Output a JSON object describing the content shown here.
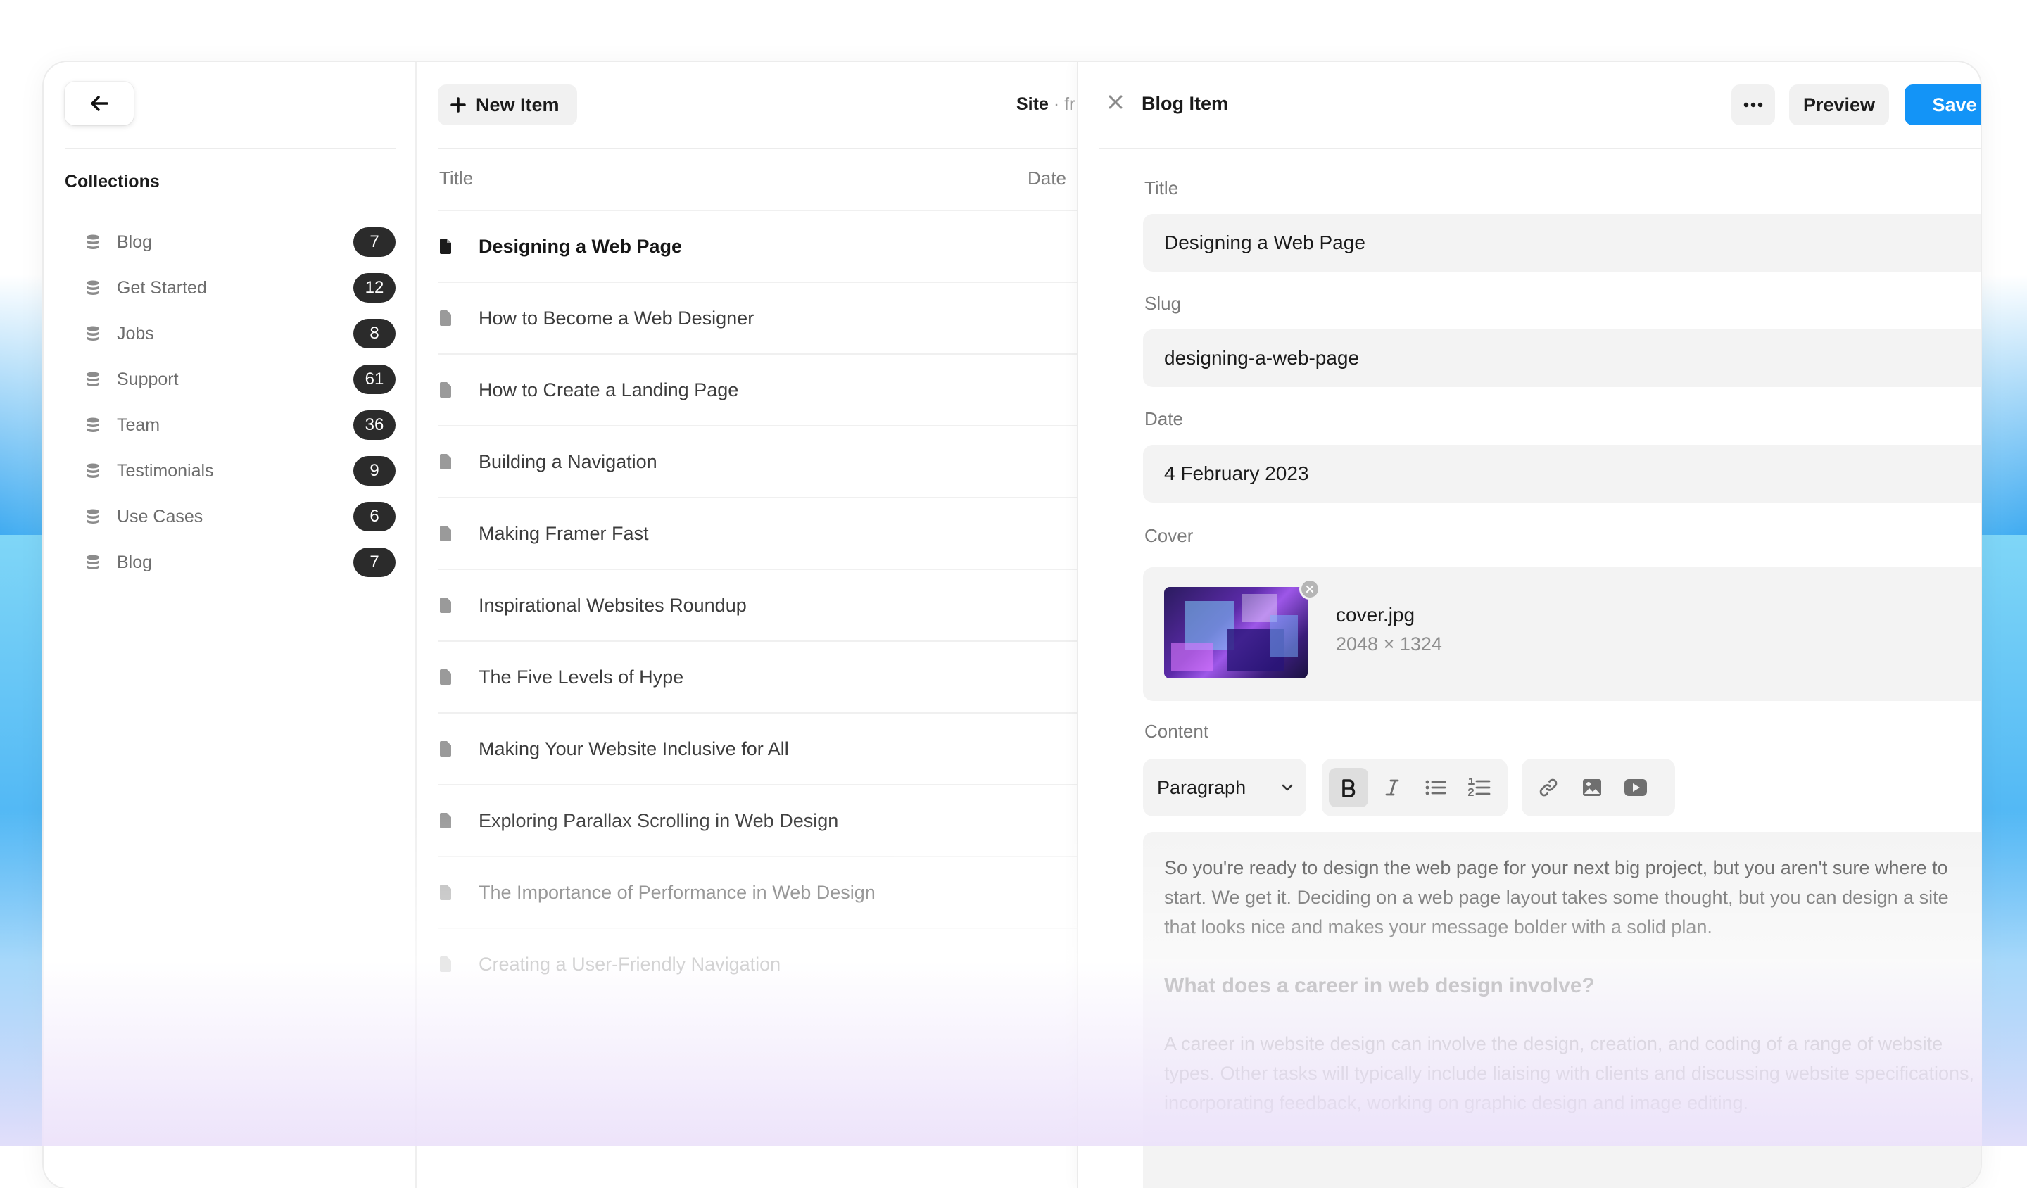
{
  "sidebar": {
    "section_title": "Collections",
    "items": [
      {
        "label": "Blog",
        "count": "7"
      },
      {
        "label": "Get Started",
        "count": "12"
      },
      {
        "label": "Jobs",
        "count": "8"
      },
      {
        "label": "Support",
        "count": "61"
      },
      {
        "label": "Team",
        "count": "36"
      },
      {
        "label": "Testimonials",
        "count": "9"
      },
      {
        "label": "Use Cases",
        "count": "6"
      },
      {
        "label": "Blog",
        "count": "7"
      }
    ]
  },
  "list": {
    "new_item_label": "New Item",
    "site_label": "Site",
    "site_separator": "·",
    "site_suffix": "fr",
    "columns": {
      "title": "Title",
      "date": "Date"
    },
    "rows": [
      "Designing a Web Page",
      "How to Become a Web Designer",
      "How to Create a Landing Page",
      "Building a Navigation",
      "Making Framer Fast",
      "Inspirational Websites Roundup",
      "The Five Levels of Hype",
      "Making Your Website Inclusive for All",
      "Exploring Parallax Scrolling in Web Design",
      "The Importance of Performance in Web Design",
      "Creating a User-Friendly Navigation"
    ]
  },
  "editor": {
    "title": "Blog Item",
    "preview_label": "Preview",
    "save_label": "Save",
    "fields": {
      "title_label": "Title",
      "title_value": "Designing a Web Page",
      "slug_label": "Slug",
      "slug_value": "designing-a-web-page",
      "date_label": "Date",
      "date_value": "4 February 2023",
      "cover_label": "Cover",
      "cover_file": "cover.jpg",
      "cover_dims": "2048 × 1324",
      "content_label": "Content"
    },
    "toolbar": {
      "paragraph_label": "Paragraph"
    },
    "content": {
      "p1": "So you're ready to design the web page for your next big project, but you aren't sure where to start. We get it. Deciding on a web page layout takes some thought, but you can design a site that looks nice and makes your message bolder with a solid plan.",
      "h1": "What does a career in web design involve?",
      "p2": "A career in website design can involve the design, creation, and coding of a range of website types. Other tasks will typically include liaising with clients and discussing website specifications, incorporating feedback, working on graphic design and image editing."
    }
  },
  "colors": {
    "accent": "#1394f7",
    "badge": "#2b2b2b"
  },
  "icons": {
    "back": "arrow-left-icon",
    "collection": "database-icon",
    "add": "plus-icon",
    "document": "document-icon",
    "close": "close-icon",
    "more": "more-horizontal-icon",
    "bold": "bold-icon",
    "italic": "italic-icon",
    "bullets": "bulleted-list-icon",
    "numbers": "numbered-list-icon",
    "link": "link-icon",
    "image": "image-icon",
    "video": "video-icon"
  }
}
